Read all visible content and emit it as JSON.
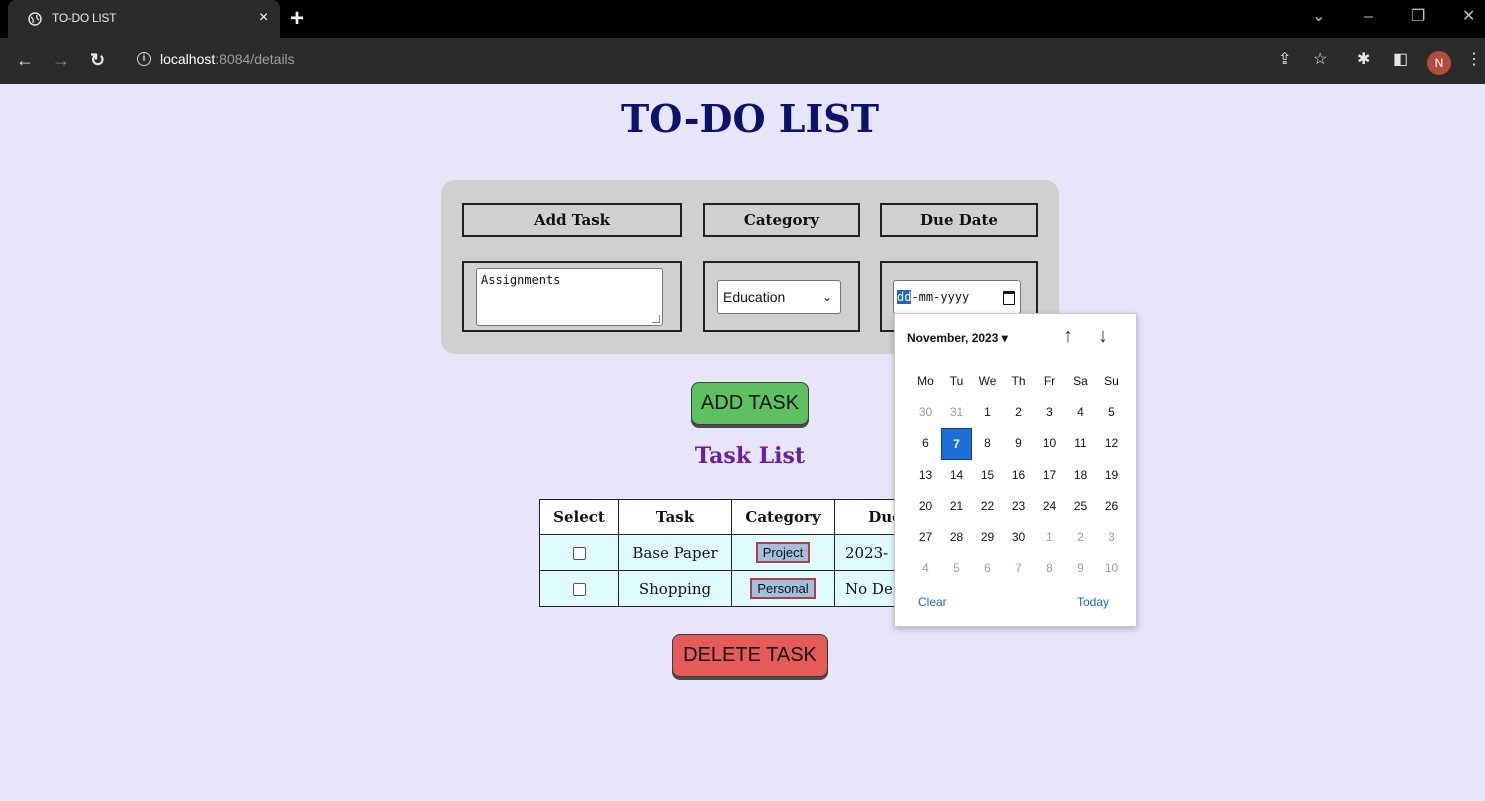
{
  "browser": {
    "tab_title": "TO-DO LIST",
    "tab_close": "×",
    "new_tab": "+",
    "url_host": "localhost",
    "url_rest": ":8084/details",
    "profile_initial": "N",
    "info_glyph": "i"
  },
  "page": {
    "title": "TO-DO LIST",
    "form": {
      "headers": {
        "task": "Add Task",
        "category": "Category",
        "due_date": "Due Date"
      },
      "task_value": "Assignments",
      "category_value": "Education",
      "date_dd": "dd",
      "date_rest": "-mm-yyyy"
    },
    "add_button": "ADD TASK",
    "list_title": "Task List",
    "table": {
      "headers": {
        "select": "Select",
        "task": "Task",
        "category": "Category",
        "due": "Due"
      },
      "rows": [
        {
          "task": "Base Paper",
          "category": "Project",
          "due": "2023-"
        },
        {
          "task": "Shopping",
          "category": "Personal",
          "due": "No De"
        }
      ]
    },
    "delete_button": "DELETE TASK"
  },
  "datepicker": {
    "month_label": "November, 2023 ▾",
    "weekdays": [
      "Mo",
      "Tu",
      "We",
      "Th",
      "Fr",
      "Sa",
      "Su"
    ],
    "weeks": [
      [
        "30",
        "31",
        "1",
        "2",
        "3",
        "4",
        "5"
      ],
      [
        "6",
        "7",
        "8",
        "9",
        "10",
        "11",
        "12"
      ],
      [
        "13",
        "14",
        "15",
        "16",
        "17",
        "18",
        "19"
      ],
      [
        "20",
        "21",
        "22",
        "23",
        "24",
        "25",
        "26"
      ],
      [
        "27",
        "28",
        "29",
        "30",
        "1",
        "2",
        "3"
      ],
      [
        "4",
        "5",
        "6",
        "7",
        "8",
        "9",
        "10"
      ]
    ],
    "selected_day": "7",
    "clear_label": "Clear",
    "today_label": "Today"
  },
  "colors": {
    "page_bg": "#e6e5fa",
    "title": "#0c116b",
    "list_title": "#6a1fa8",
    "add_button": "#5cc15e",
    "delete_button": "#e65b58",
    "table_cell": "#dffbff",
    "tag_bg": "#9ec2dd",
    "selected_day": "#1a6fd9"
  }
}
